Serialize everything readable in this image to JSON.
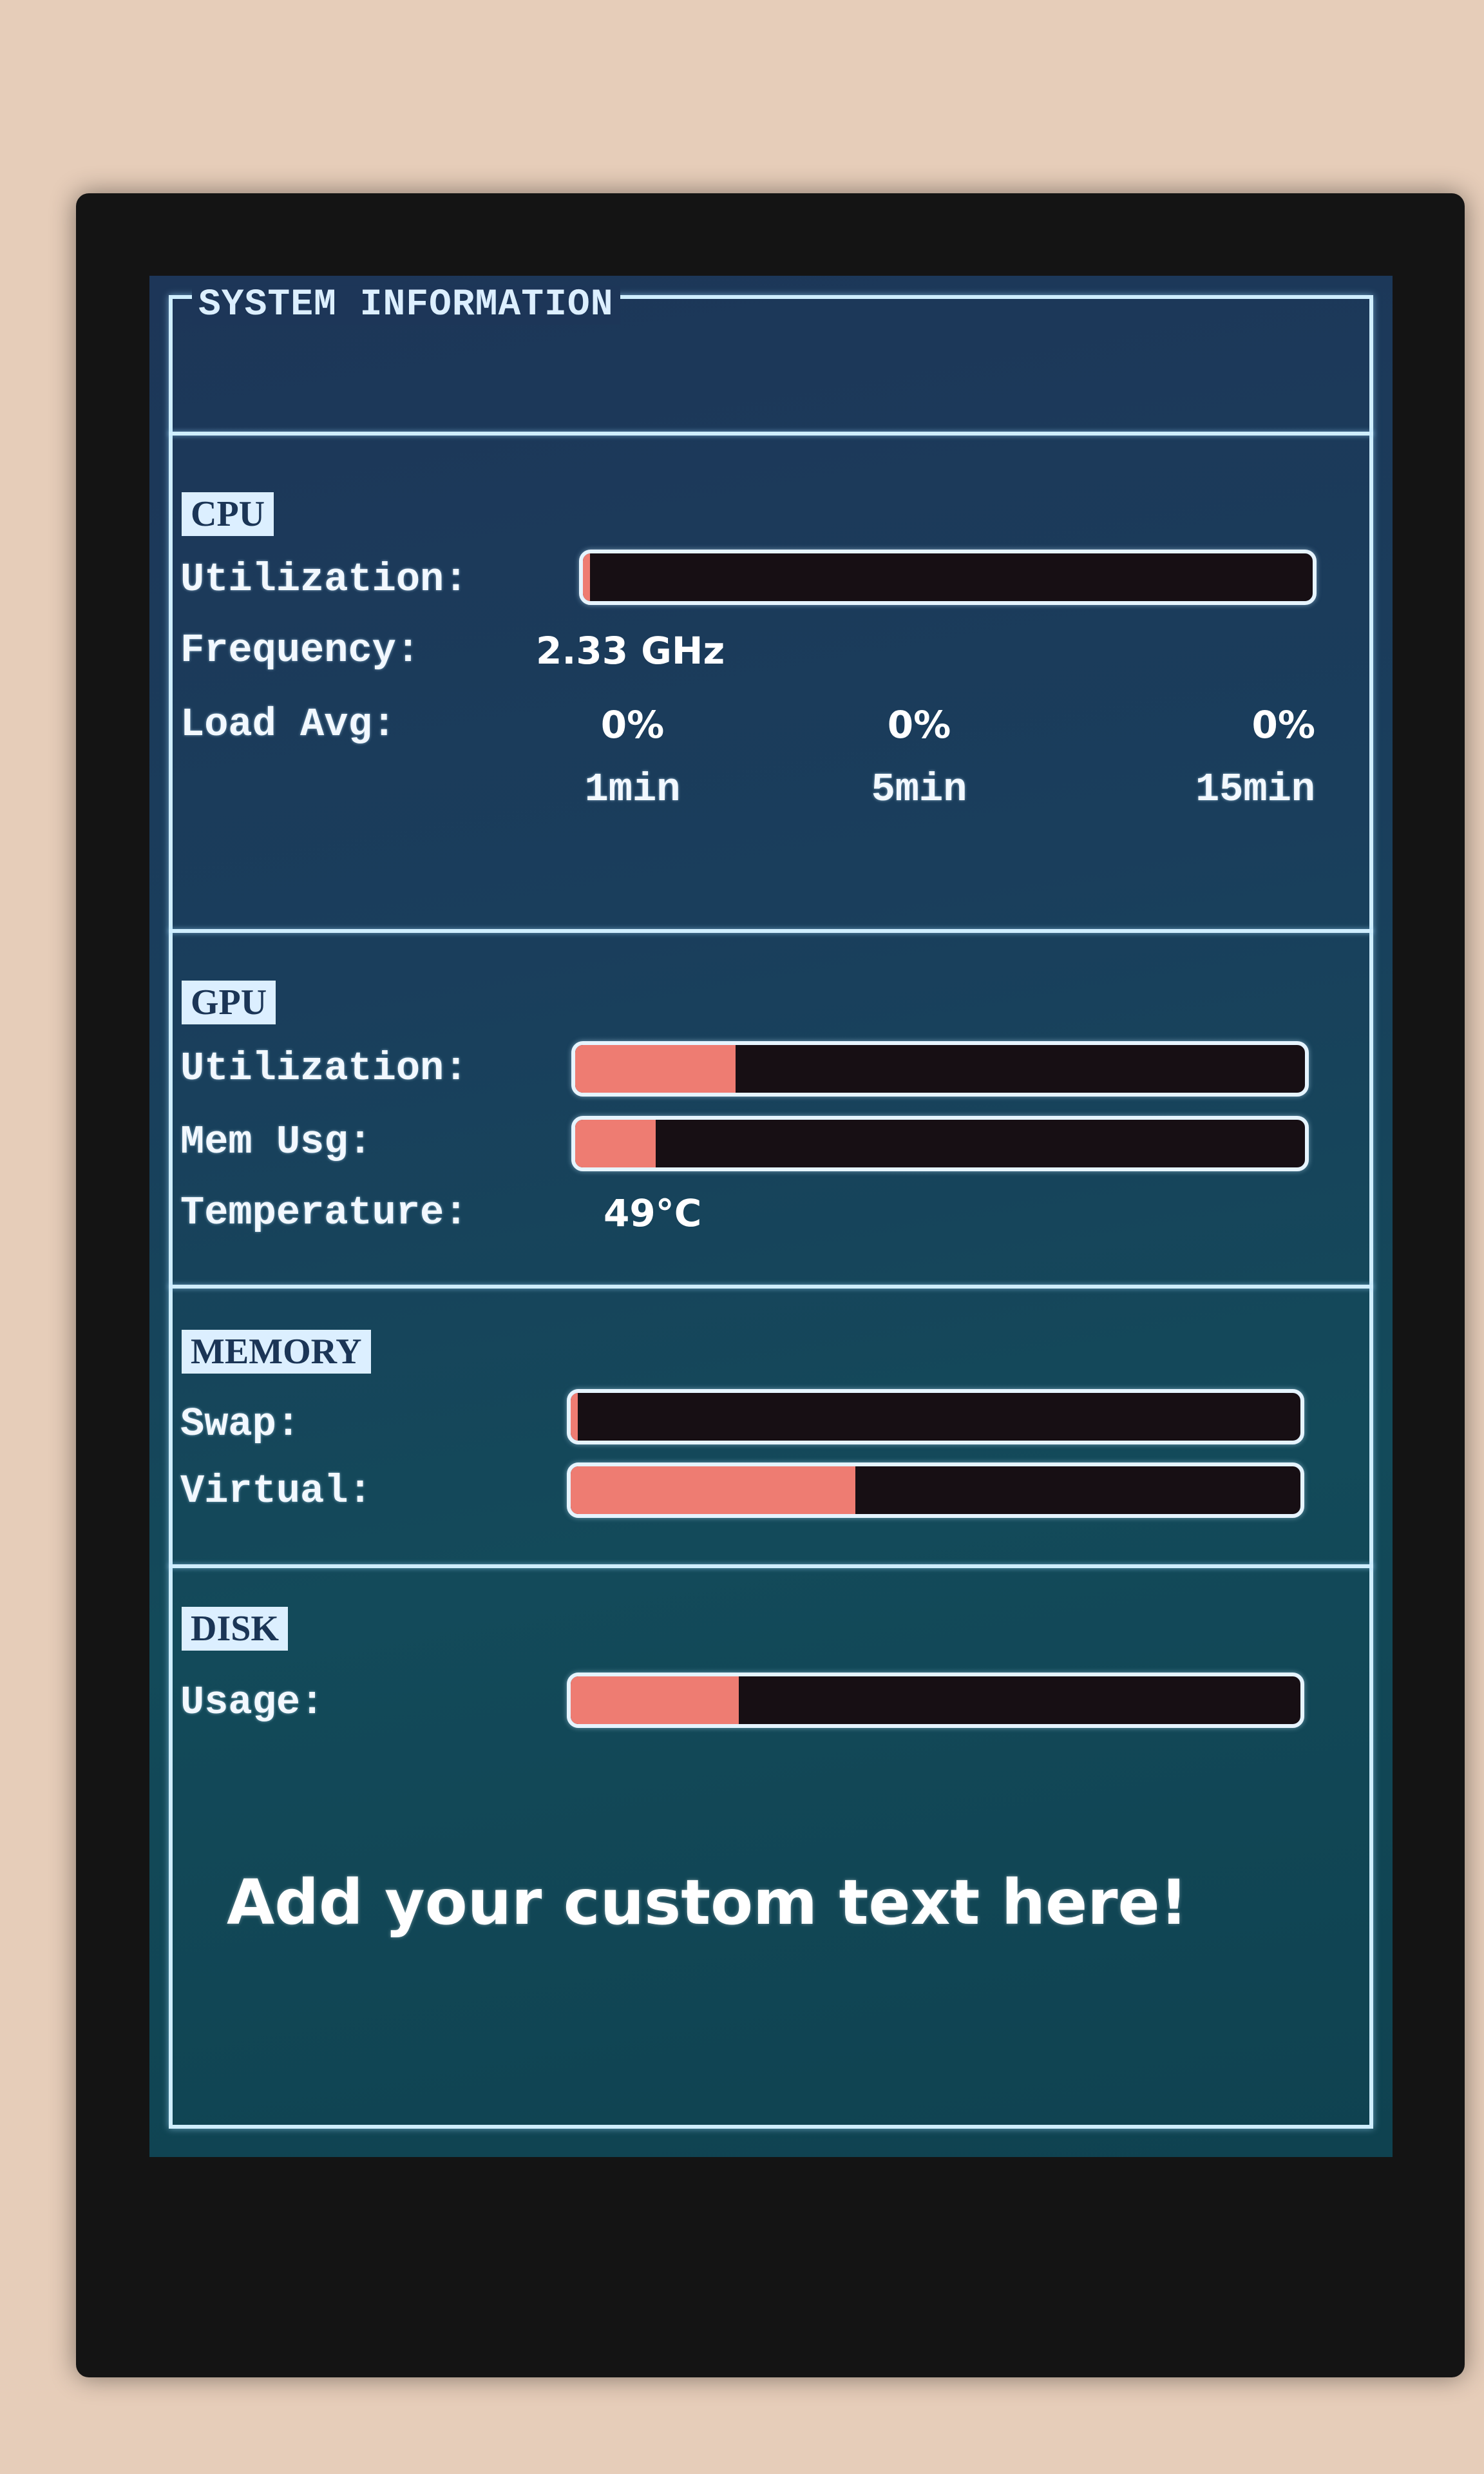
{
  "screen": {
    "title": "SYSTEM INFORMATION",
    "custom_text": "Add your custom text here!"
  },
  "cpu": {
    "header": "CPU",
    "utilization_label": "Utilization:",
    "utilization_fraction": 0.01,
    "frequency_label": "Frequency:",
    "frequency_value": "2.33 GHz",
    "load_avg_label": "Load Avg:",
    "load_values": [
      "0%",
      "0%",
      "0%"
    ],
    "load_periods": [
      "1min",
      "5min",
      "15min"
    ]
  },
  "gpu": {
    "header": "GPU",
    "utilization_label": "Utilization:",
    "utilization_fraction": 0.22,
    "mem_usage_label": "Mem Usg:",
    "mem_usage_fraction": 0.11,
    "temperature_label": "Temperature:",
    "temperature_value": "49°C"
  },
  "memory": {
    "header": "MEMORY",
    "swap_label": "Swap:",
    "swap_fraction": 0.01,
    "virtual_label": "Virtual:",
    "virtual_fraction": 0.39
  },
  "disk": {
    "header": "DISK",
    "usage_label": "Usage:",
    "usage_fraction": 0.23
  },
  "colors": {
    "bar_fill": "#ee7c72",
    "bar_track": "#170f14",
    "frame": "#cfeeff"
  }
}
